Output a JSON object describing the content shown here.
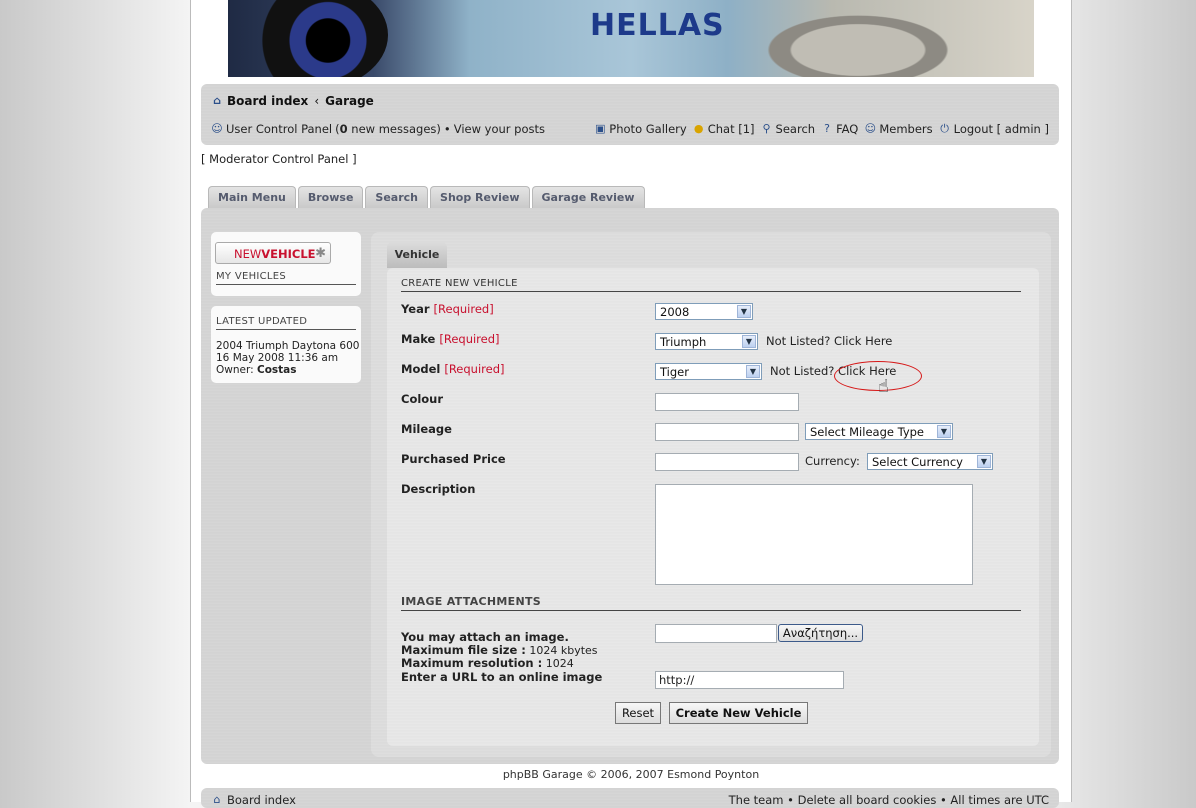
{
  "banner": {
    "logo_text": "HELLAS"
  },
  "breadcrumb": {
    "home": "Board index",
    "separator": "‹",
    "current": "Garage"
  },
  "user_bar": {
    "ucp_label": "User Control Panel",
    "messages_count": "0",
    "messages_text": "new messages",
    "bullet": "•",
    "view_posts": "View your posts"
  },
  "top_links": {
    "photo_gallery": "Photo Gallery",
    "chat": "Chat [1]",
    "search": "Search",
    "faq": "FAQ",
    "members": "Members",
    "logout": "Logout [ admin ]"
  },
  "moderator_link": "[ Moderator Control Panel ]",
  "tabs": [
    "Main Menu",
    "Browse",
    "Search",
    "Shop Review",
    "Garage Review"
  ],
  "sidebar": {
    "new_vehicle_prefix": "NEW",
    "new_vehicle_suffix": "VEHICLE",
    "my_vehicles": "MY VEHICLES",
    "latest_updated": "LATEST UPDATED",
    "latest_vehicle": "2004 Triumph Daytona 600",
    "latest_date": "16 May 2008 11:36 am",
    "owner_label": "Owner:",
    "owner_name": "Costas"
  },
  "form": {
    "tab_label": "Vehicle",
    "section_title": "CREATE NEW VEHICLE",
    "year_label": "Year",
    "required": "[Required]",
    "year_value": "2008",
    "make_label": "Make",
    "make_value": "Triumph",
    "not_listed": "Not Listed? Click Here",
    "model_label": "Model",
    "model_value": "Tiger",
    "colour_label": "Colour",
    "mileage_label": "Mileage",
    "mileage_type": "Select Mileage Type",
    "price_label": "Purchased Price",
    "currency_label": "Currency:",
    "currency_value": "Select Currency",
    "description_label": "Description",
    "image_section": "IMAGE ATTACHMENTS",
    "attach_label": "You may attach an image.",
    "max_size_label": "Maximum file size :",
    "max_size_value": "1024 kbytes",
    "max_res_label": "Maximum resolution :",
    "max_res_value": "1024",
    "browse_button": "Αναζήτηση...",
    "url_label": "Enter a URL to an online image",
    "url_value": "http://",
    "reset_button": "Reset",
    "submit_button": "Create New Vehicle"
  },
  "footer": {
    "product": "phpBB Garage",
    "copyright": "© 2006, 2007 Esmond Poynton"
  },
  "bottom_bar": {
    "home": "Board index",
    "right_text": "The team • Delete all board cookies • All times are UTC"
  }
}
